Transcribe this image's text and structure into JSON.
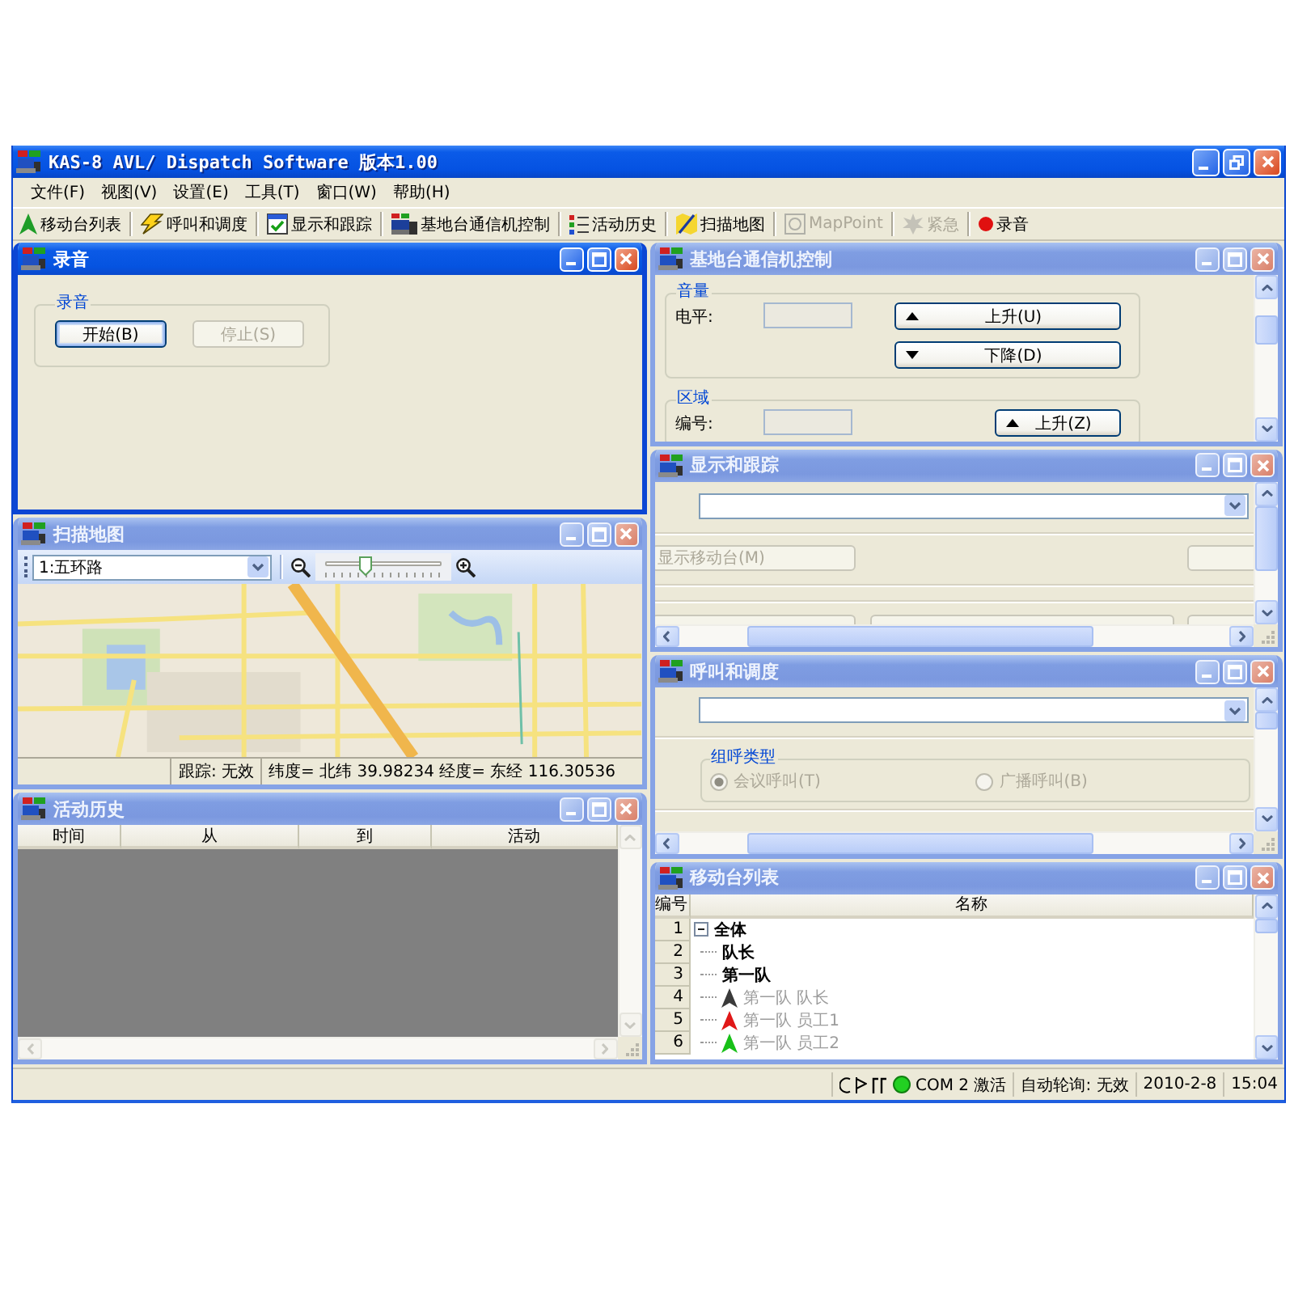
{
  "window": {
    "title": "KAS-8 AVL/ Dispatch Software 版本1.00"
  },
  "menu": [
    "文件(F)",
    "视图(V)",
    "设置(E)",
    "工具(T)",
    "窗口(W)",
    "帮助(H)"
  ],
  "toolbar": [
    {
      "kind": "mobile",
      "label": "移动台列表",
      "disabled": false
    },
    {
      "kind": "dispatch",
      "label": "呼叫和调度",
      "disabled": false
    },
    {
      "kind": "tracking",
      "label": "显示和跟踪",
      "disabled": false
    },
    {
      "kind": "radio",
      "label": "基地台通信机控制",
      "disabled": false
    },
    {
      "kind": "history",
      "label": "活动历史",
      "disabled": false
    },
    {
      "kind": "map",
      "label": "扫描地图",
      "disabled": false
    },
    {
      "kind": "mappoint",
      "label": "MapPoint",
      "disabled": true
    },
    {
      "kind": "emergency",
      "label": "紧急",
      "disabled": true
    },
    {
      "kind": "record",
      "label": "录音",
      "disabled": false
    }
  ],
  "left_column": [
    {
      "kind": "recording",
      "title": "录音",
      "active": true,
      "group": "录音",
      "buttons": [
        {
          "label": "开始(B)",
          "disabled": false,
          "focused": true
        },
        {
          "label": "停止(S)",
          "disabled": true,
          "focused": false
        }
      ]
    },
    {
      "kind": "map",
      "title": "扫描地图",
      "active": false,
      "route": "1:五环路",
      "zoom": {
        "level": 0.35
      },
      "status": [
        "跟踪: 无效",
        "纬度= 北纬 39.98234 经度= 东经 116.30536"
      ]
    },
    {
      "kind": "history",
      "title": "活动历史",
      "active": false,
      "columns": [
        "时间",
        "从",
        "到",
        "活动"
      ]
    }
  ],
  "right_column": [
    {
      "kind": "radio",
      "title": "基地台通信机控制",
      "active": false,
      "groups": [
        {
          "label": "音量",
          "field_label": "电平:",
          "buttons": [
            {
              "kind": "up",
              "label": "上升(U)"
            },
            {
              "kind": "down",
              "label": "下降(D)"
            }
          ]
        },
        {
          "label": "区域",
          "field_label": "编号:",
          "buttons": [
            {
              "kind": "up",
              "label": "上升(Z)"
            }
          ]
        }
      ]
    },
    {
      "kind": "tracking",
      "title": "显示和跟踪",
      "active": false,
      "button_rows": [
        [
          {
            "label": "显示移动台(M)",
            "disabled": true
          },
          {
            "disabled": true
          }
        ],
        [
          {
            "disabled": true
          },
          {
            "disabled": true
          },
          {
            "disabled": true
          }
        ]
      ]
    },
    {
      "kind": "dispatch",
      "title": "呼叫和调度",
      "active": false,
      "group": {
        "label": "组呼类型",
        "options": [
          {
            "label": "会议呼叫(T)",
            "selected": true,
            "disabled": true
          },
          {
            "label": "广播呼叫(B)",
            "selected": false,
            "disabled": true
          }
        ]
      }
    },
    {
      "kind": "mobile_list",
      "title": "移动台列表",
      "active": false,
      "columns": [
        "编号",
        "名称"
      ],
      "rows": [
        {
          "number": "1",
          "name": "全体",
          "kind": "group",
          "expanded": true,
          "children": [
            {
              "number": "2",
              "name": "队长",
              "kind": "group"
            },
            {
              "number": "3",
              "name": "第一队",
              "kind": "group"
            },
            {
              "number": "4",
              "name": "第一队 队长",
              "kind": "unit",
              "color": "#3a3a3a"
            },
            {
              "number": "5",
              "name": "第一队 员工1",
              "kind": "unit",
              "color": "#e01818"
            },
            {
              "number": "6",
              "name": "第一队 员工2",
              "kind": "unit",
              "color": "#18c018"
            }
          ]
        }
      ]
    }
  ],
  "status_bar": {
    "com": {
      "label": "COM 2 激活",
      "active": true
    },
    "polling": "自动轮询: 无效",
    "date": "2010-2-8",
    "time": "15:04"
  }
}
